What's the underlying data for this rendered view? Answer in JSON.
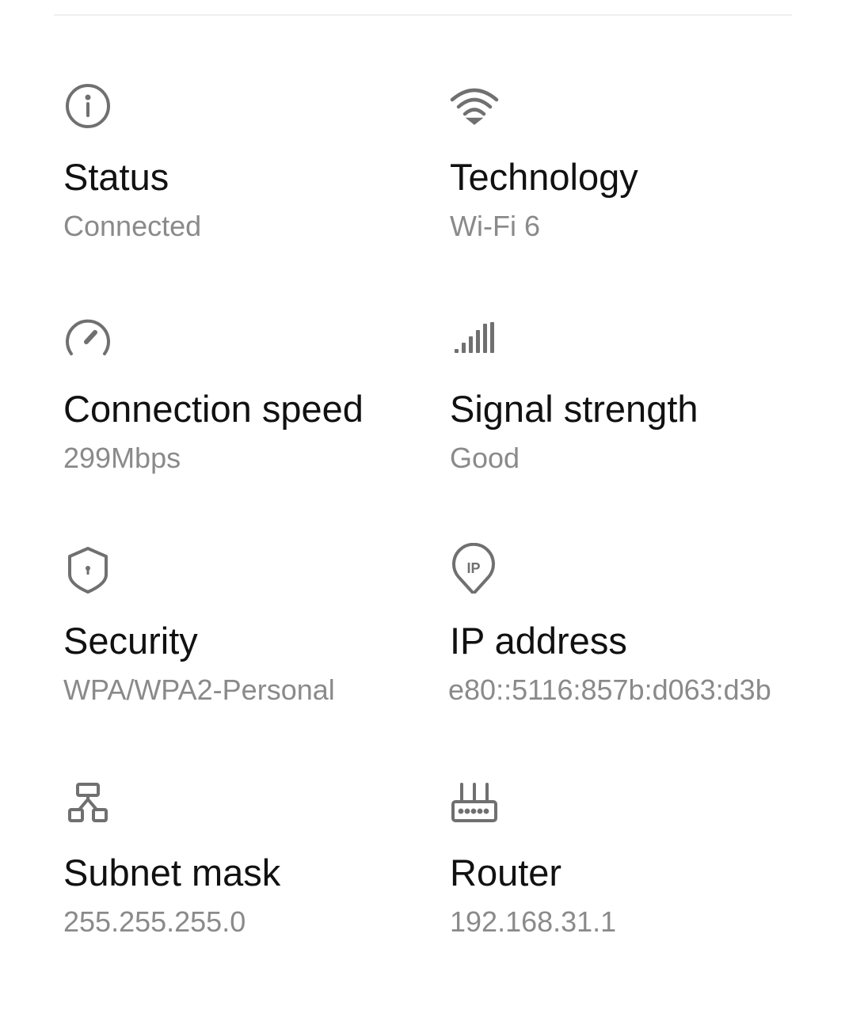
{
  "items": [
    {
      "icon": "info-icon",
      "label": "Status",
      "value": "Connected"
    },
    {
      "icon": "wifi-icon",
      "label": "Technology",
      "value": "Wi-Fi 6"
    },
    {
      "icon": "speedometer-icon",
      "label": "Connection speed",
      "value": "299Mbps"
    },
    {
      "icon": "signal-bars-icon",
      "label": "Signal strength",
      "value": "Good"
    },
    {
      "icon": "shield-lock-icon",
      "label": "Security",
      "value": "WPA/WPA2-Personal"
    },
    {
      "icon": "ip-location-icon",
      "label": "IP address",
      "value": "e80::5116:857b:d063:d3b"
    },
    {
      "icon": "network-tree-icon",
      "label": "Subnet mask",
      "value": "255.255.255.0"
    },
    {
      "icon": "router-icon",
      "label": "Router",
      "value": "192.168.31.1"
    }
  ],
  "colors": {
    "background": "#ffffff",
    "label": "#111111",
    "value": "#8a8a8a",
    "icon": "#707070",
    "divider": "#efefef"
  }
}
